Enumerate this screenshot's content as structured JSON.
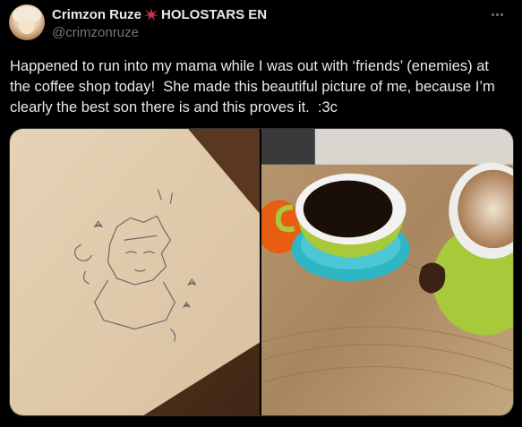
{
  "author": {
    "display_name": "Crimzon Ruze",
    "name_suffix": "HOLOSTARS EN",
    "handle": "@crimzonruze"
  },
  "tweet": {
    "text": "Happened to run into my mama while I was out with ‘friends’ (enemies) at the coffee shop today!  She made this beautiful picture of me, because I’m clearly the best son there is and this proves it.  :3c"
  },
  "icons": {
    "name_badge": "crimson-sparkle-icon",
    "menu": "more-options-icon"
  },
  "colors": {
    "background": "#000000",
    "text": "#e7e9ea",
    "secondary_text": "#71767b",
    "badge": "#c8314a"
  }
}
